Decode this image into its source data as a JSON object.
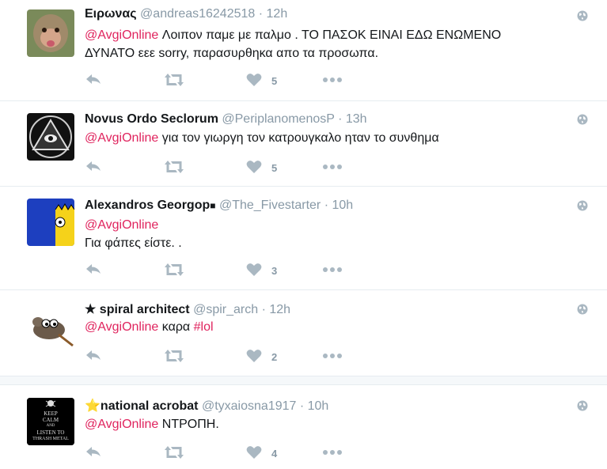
{
  "tweets": [
    {
      "name": "Ειρωνας",
      "handle": "@andreas16242518",
      "time": "12h",
      "mention": "@AvgiOnline",
      "text1": " Λοιπον παμε με παλμο . ΤΟ ΠΑΣΟΚ ΕΙΝΑΙ ΕΔΩ ΕΝΩΜΕΝΟ",
      "text2": "ΔΥΝΑΤΟ εεε sorry, παρασυρθηκα απο τα προσωπα.",
      "likes": "5"
    },
    {
      "name": "Novus Ordo Seclorum",
      "handle": "@PeriplanomenosP",
      "time": "13h",
      "mention": "@AvgiOnline",
      "text1": " για τον γιωργη τον κατρουγκαλο ηταν το συνθημα",
      "likes": "5"
    },
    {
      "name": "Alexandros Georgop",
      "name_suffix": "■",
      "handle": "@The_Fivestarter",
      "time": "10h",
      "mention": "@AvgiOnline",
      "text2": "Για φάπες είστε. .",
      "likes": "3"
    },
    {
      "name_prefix": "★",
      "name": "spiral architect",
      "handle": "@spir_arch",
      "time": "12h",
      "mention": "@AvgiOnline",
      "text1": " καρα ",
      "hashtag": "#lol",
      "likes": "2"
    },
    {
      "name_prefix": "⭐",
      "name": "national acrobat",
      "handle": "@tyxaiosna1917",
      "time": "10h",
      "mention": "@AvgiOnline",
      "text1": " ΝΤΡΟΠΗ.",
      "likes": "4",
      "avatar_lines": [
        "KEEP",
        "CALM",
        "AND",
        "LISTEN TO",
        "THRASH METAL"
      ]
    }
  ],
  "dot": "·",
  "colors": {
    "accent": "#e0245e",
    "muted": "#8899a6",
    "divider": "#e6ecf0"
  },
  "icons": [
    "reply-icon",
    "retweet-icon",
    "like-icon",
    "more-icon",
    "globe-icon"
  ]
}
